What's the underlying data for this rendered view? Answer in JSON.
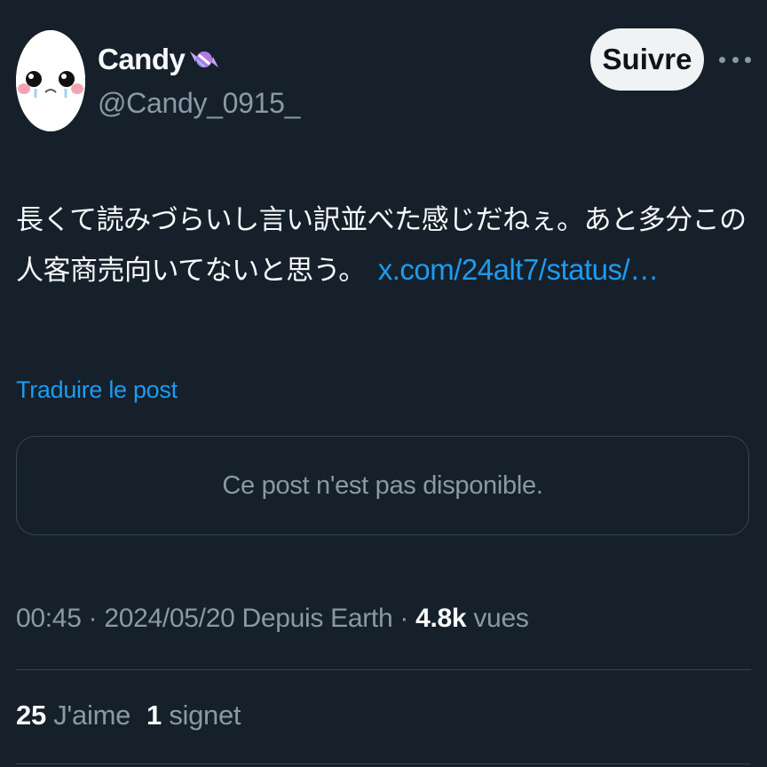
{
  "author": {
    "display_name": "Candy",
    "handle": "@Candy_0915_",
    "name_emoji": "candy-icon",
    "avatar": "cartoon-face-avatar"
  },
  "follow_button": {
    "label": "Suivre"
  },
  "more_menu": {
    "icon": "more-horizontal-icon"
  },
  "tweet": {
    "text": "長くて読みづらいし言い訳並べた感じだねぇ。あと多分この人客商売向いてないと思う。",
    "link_text": "x.com/24alt7/status/…"
  },
  "translate_link": "Traduire le post",
  "quoted_post": {
    "message": "Ce post n'est pas disponible."
  },
  "meta": {
    "time_date": "00:45 · 2024/05/20 Depuis Earth · ",
    "views_count": "4.8k",
    "views_label": "vues"
  },
  "stats": {
    "likes_count": "25",
    "likes_label": "J'aime",
    "bookmarks_count": "1",
    "bookmarks_label": "signet"
  },
  "colors": {
    "background": "#15202b",
    "text": "#f7f9f9",
    "muted": "#8b98a5",
    "link": "#1d9bf0",
    "border": "#38444d"
  }
}
